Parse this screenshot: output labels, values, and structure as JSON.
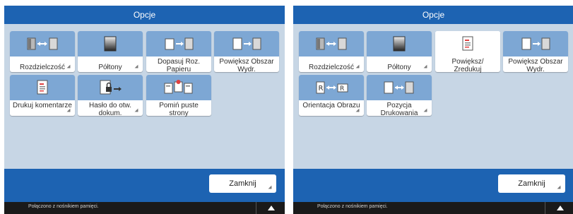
{
  "colors": {
    "title_bg": "#1d63b2",
    "panel_bg": "#c7d6e5",
    "tile_top": "#7da7d4",
    "status_bg": "#1a1a1a"
  },
  "left": {
    "title": "Opcje",
    "tiles": [
      {
        "label": "Rozdzielczość",
        "icon": "resolution-icon"
      },
      {
        "label": "Półtony",
        "icon": "halftone-icon"
      },
      {
        "label": "Dopasuj Roz. Papieru",
        "icon": "fit-paper-size-icon"
      },
      {
        "label": "Powiększ Obszar Wydr.",
        "icon": "enlarge-print-area-icon"
      },
      {
        "label": "Drukuj komentarze",
        "icon": "print-comments-icon"
      },
      {
        "label": "Hasło do otw. dokum.",
        "icon": "document-password-icon"
      },
      {
        "label": "Pomiń puste strony",
        "icon": "skip-blank-pages-icon"
      }
    ],
    "close_label": "Zamknij",
    "status_text": "Połączono z nośnikiem pamięci."
  },
  "right": {
    "title": "Opcje",
    "tiles": [
      {
        "label": "Rozdzielczość",
        "icon": "resolution-icon"
      },
      {
        "label": "Półtony",
        "icon": "halftone-icon"
      },
      {
        "label": "Powiększ/ Zredukuj",
        "icon": "zoom-icon"
      },
      {
        "label": "Powiększ Obszar Wydr.",
        "icon": "enlarge-print-area-icon"
      },
      {
        "label": "Orientacja Obrazu",
        "icon": "image-orientation-icon"
      },
      {
        "label": "Pozycja Drukowania",
        "icon": "print-position-icon"
      }
    ],
    "close_label": "Zamknij",
    "status_text": "Połączono z nośnikiem pamięci."
  }
}
